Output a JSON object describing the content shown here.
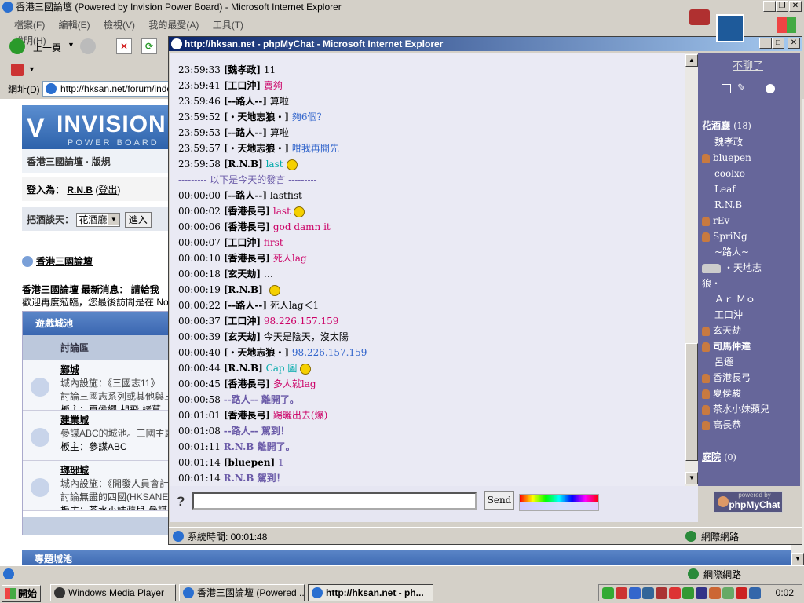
{
  "ie_main": {
    "title": "香港三國論壇 (Powered by Invision Power Board) - Microsoft Internet Explorer",
    "menu": [
      "檔案(F)",
      "編輯(E)",
      "檢視(V)",
      "我的最愛(A)",
      "工具(T)",
      "說明(H)"
    ],
    "back_label": "上一頁",
    "address_label": "網址(D)",
    "address_value": "http://hksan.net/forum/index.",
    "status_zone": "網際網路"
  },
  "forum": {
    "logo_text": "INVISION",
    "logo_sub": "POWER BOARD",
    "breadcrumb": "香港三國論壇 · 版規",
    "login_label": "登入為：",
    "login_user": "R.N.B",
    "login_paren_open": "(",
    "logout_link": "登出",
    "login_paren_close": ")",
    "chat_label": "把酒談天：",
    "chat_select": "花酒廳",
    "enter_button": "進入",
    "forum_title": "香港三國論壇",
    "news_line": "香港三國論壇 最新消息： 請給我",
    "welcome_line": "歡迎再度蒞臨，您最後訪問是在 No",
    "category": "遊戲城池",
    "col_header": "討論區",
    "rows": [
      {
        "name": "鄴城",
        "l1": "城內設施：《三國志11》",
        "l2": "討論三國志系列或其他與三",
        "mods_label": "板主：",
        "mods": [
          "夏侯纓",
          "胡飛",
          "諸葛"
        ]
      },
      {
        "name": "建業城",
        "l1": "參謀ABC的城池。三國主題",
        "l2": "",
        "mods_label": "板主：",
        "mods": [
          "參謀ABC"
        ]
      },
      {
        "name": "瑯琊城",
        "l1": "城內設施：《開發人員會計",
        "l2": "討論無盡的四國(HKSANE",
        "mods_label": "板主：",
        "mods": [
          "茶水小妹蘋兒",
          "參謀"
        ]
      }
    ],
    "category2": "專題城池"
  },
  "chat": {
    "title": "http://hksan.net - phpMyChat - Microsoft Internet Explorer",
    "lines": [
      {
        "t": "23:59:33",
        "n": "[魏孝政]",
        "m": "11",
        "c": "#000000"
      },
      {
        "t": "23:59:41",
        "n": "[工口沖]",
        "m": "賣夠",
        "c": "#cc0066"
      },
      {
        "t": "23:59:46",
        "n": "[--路人--]",
        "m": "算啦",
        "c": "#000000"
      },
      {
        "t": "23:59:52",
        "n": "[・天地志狼・]",
        "m": "夠6個？",
        "c": "#3366cc"
      },
      {
        "t": "23:59:53",
        "n": "[--路人--]",
        "m": "算啦",
        "c": "#000000"
      },
      {
        "t": "23:59:57",
        "n": "[・天地志狼・]",
        "m": "咁我再開先",
        "c": "#3366cc"
      },
      {
        "t": "23:59:58",
        "n": "[R.N.B]",
        "m": "last",
        "c": "#00aaaa",
        "smile": true
      },
      {
        "sep": "--------- 以下是今天的發言 ---------"
      },
      {
        "t": "00:00:00",
        "n": "[--路人--]",
        "m": "lastfist",
        "c": "#000000"
      },
      {
        "t": "00:00:02",
        "n": "[香港長弓]",
        "m": "last",
        "c": "#cc0066",
        "smile": true
      },
      {
        "t": "00:00:06",
        "n": "[香港長弓]",
        "m": "god damn it",
        "c": "#cc0066"
      },
      {
        "t": "00:00:07",
        "n": "[工口沖]",
        "m": "first",
        "c": "#cc0066"
      },
      {
        "t": "00:00:10",
        "n": "[香港長弓]",
        "m": "死人lag",
        "c": "#cc0066"
      },
      {
        "t": "00:00:18",
        "n": "[玄天劫]",
        "m": "…",
        "c": "#000000"
      },
      {
        "t": "00:00:19",
        "n": "[R.N.B]",
        "m": "",
        "c": "#00aaaa",
        "smile": true
      },
      {
        "t": "00:00:22",
        "n": "[--路人--]",
        "m": "死人lag＜1",
        "c": "#000000"
      },
      {
        "t": "00:00:37",
        "n": "[工口沖]",
        "m": "98.226.157.159",
        "c": "#cc0066"
      },
      {
        "t": "00:00:39",
        "n": "[玄天劫]",
        "m": "今天是陰天，沒太陽",
        "c": "#000000"
      },
      {
        "t": "00:00:40",
        "n": "[・天地志狼・]",
        "m": "98.226.157.159",
        "c": "#3366cc"
      },
      {
        "t": "00:00:44",
        "n": "[R.N.B]",
        "m": "Cap 圖",
        "c": "#00aaaa",
        "smile": true
      },
      {
        "t": "00:00:45",
        "n": "[香港長弓]",
        "m": "多人就lag",
        "c": "#cc0066"
      },
      {
        "t": "00:00:58",
        "n": "",
        "m": "--路人-- 離開了。",
        "c": "#6a5aa8",
        "sys": true
      },
      {
        "t": "00:01:01",
        "n": "[香港長弓]",
        "m": "踢曬出去(爆)",
        "c": "#cc0066"
      },
      {
        "t": "00:01:08",
        "n": "",
        "m": "--路人-- 駕到！",
        "c": "#6a5aa8",
        "sys": true
      },
      {
        "t": "00:01:11",
        "n": "",
        "m": "R.N.B 離開了。",
        "c": "#6a5aa8",
        "sys": true
      },
      {
        "t": "00:01:14",
        "n": "[bluepen]",
        "m": "1",
        "c": "#6a5aa8"
      },
      {
        "t": "00:01:14",
        "n": "",
        "m": "R.N.B 駕到！",
        "c": "#6a5aa8",
        "sys": true
      }
    ],
    "quit_link": "不聊了",
    "room_name": "花酒廳",
    "room_count": "(18)",
    "users": [
      {
        "n": "魏孝政",
        "ic": false
      },
      {
        "n": "bluepen",
        "ic": true
      },
      {
        "n": "coolxo",
        "ic": false
      },
      {
        "n": "Leaf",
        "ic": false
      },
      {
        "n": "R.N.B",
        "ic": false
      },
      {
        "n": "rEv",
        "ic": true
      },
      {
        "n": "SpriNg",
        "ic": true
      },
      {
        "n": "~路人~",
        "ic": false
      },
      {
        "n": "・天地志",
        "ic": true,
        "wide": true
      },
      {
        "n": "狼・",
        "ic": false,
        "indent": 0
      },
      {
        "n": "Ａｒ Ｍｏ",
        "ic": false
      },
      {
        "n": "工口沖",
        "ic": false
      },
      {
        "n": "玄天劫",
        "ic": true
      },
      {
        "n": "司馬仲達",
        "ic": true,
        "bold": true
      },
      {
        "n": "呂遜",
        "ic": false
      },
      {
        "n": "香港長弓",
        "ic": true
      },
      {
        "n": "夏侯駿",
        "ic": true
      },
      {
        "n": "茶水小妹蘋兒",
        "ic": true
      },
      {
        "n": "高長恭",
        "ic": true
      }
    ],
    "room2_name": "庭院",
    "room2_count": "(0)",
    "help_glyph": "?",
    "send_button": "Send",
    "powered_small": "powered by",
    "powered_big": "phpMyChat",
    "status_text": "系統時間: 00:01:48",
    "status_zone": "網際網路"
  },
  "taskbar": {
    "start": "開始",
    "items": [
      "Windows Media Player",
      "香港三國論壇 (Powered ...",
      "http://hksan.net - ph..."
    ],
    "clock": "0:02"
  }
}
